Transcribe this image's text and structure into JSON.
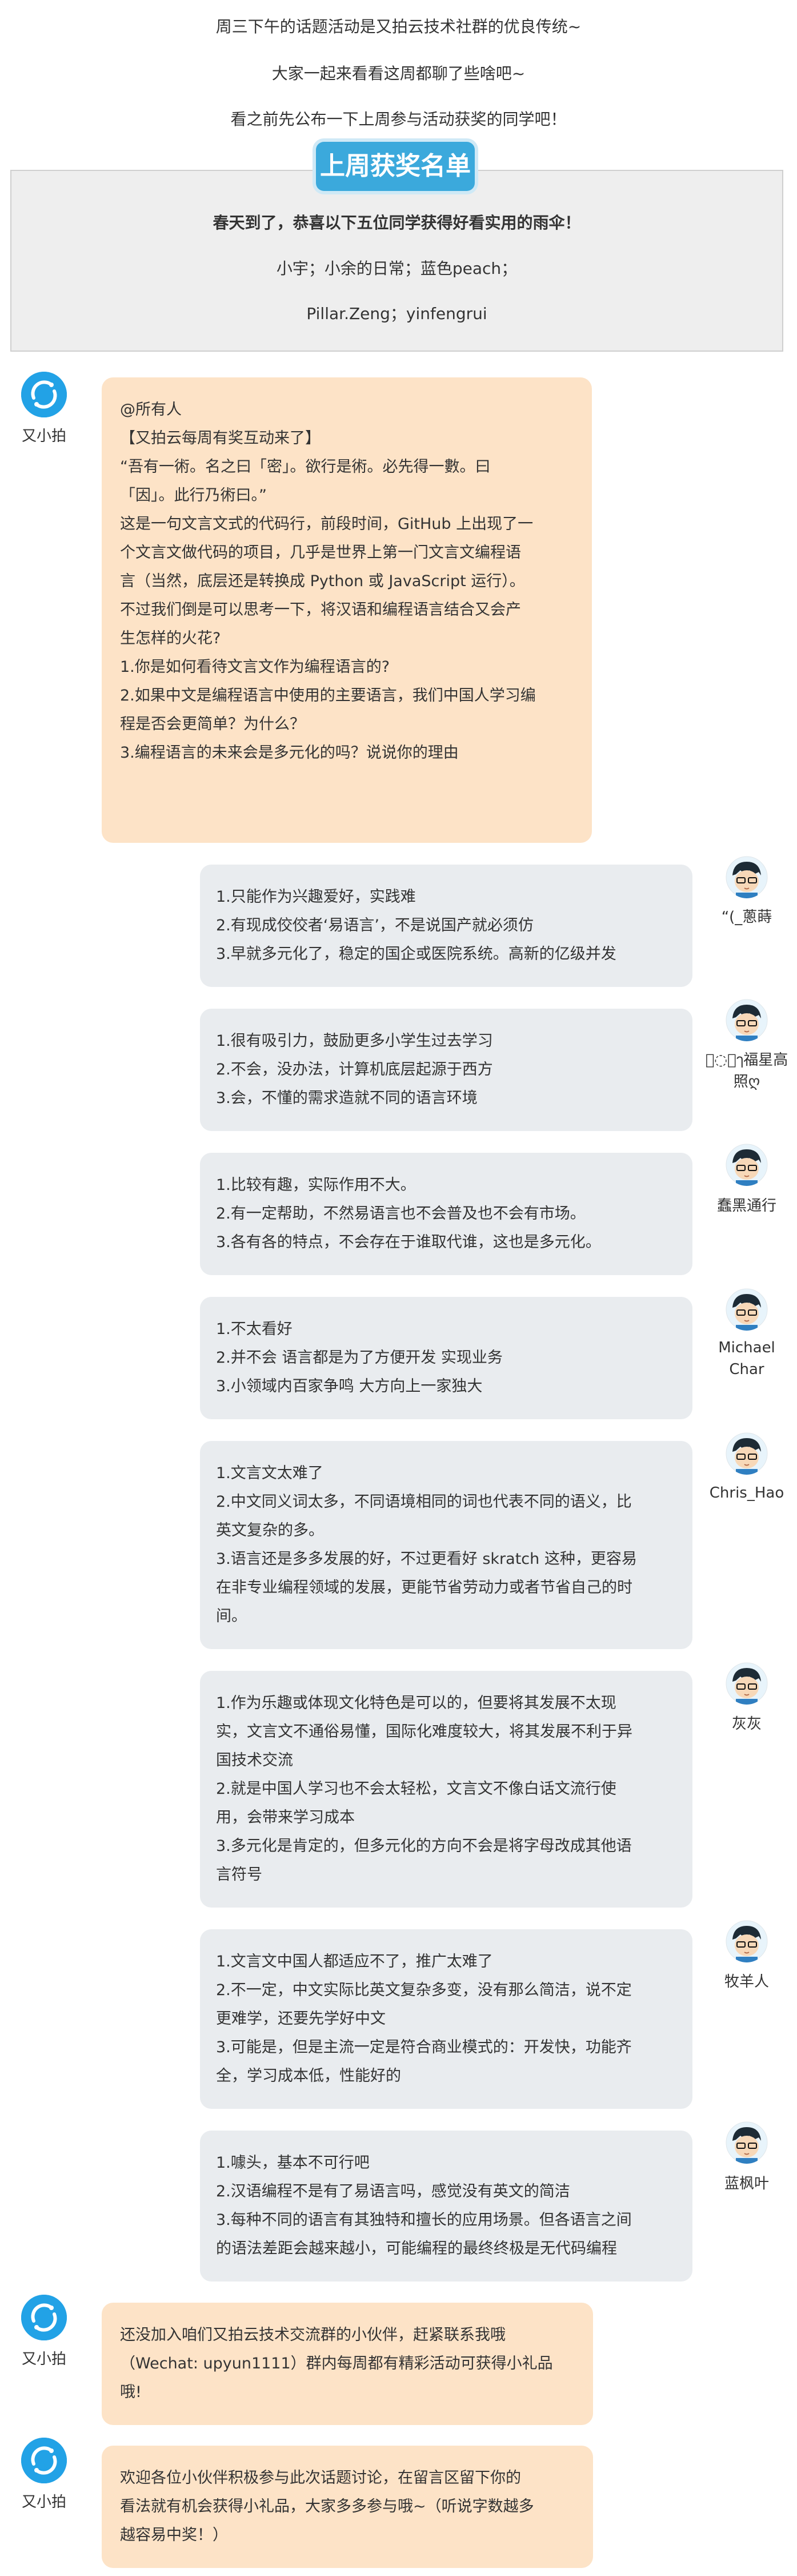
{
  "intro": [
    "周三下午的话题活动是又拍云技术社群的优良传统~",
    "大家一起来看看这周都聊了些啥吧~",
    "看之前先公布一下上周参与活动获奖的同学吧！"
  ],
  "award": {
    "title": "上周获奖名单",
    "line1": "春天到了，恭喜以下五位同学获得好看实用的雨伞！",
    "line2": "小宇；小余的日常；蓝色peach；",
    "line3": "Pillar.Zeng；yinfengrui"
  },
  "host_name": "又小拍",
  "post": {
    "lines": [
      "@所有人",
      "",
      "【又拍云每周有奖互动来了】",
      "“吾有一術。名之曰「密」。欲行是術。必先得一數。曰",
      "「因」。此行乃術曰。”",
      "这是一句文言文式的代码行，前段时间，GitHub 上出现了一",
      "个文言文做代码的项目，几乎是世界上第一门文言文编程语",
      "言（当然，底层还是转换成 Python 或 JavaScript 运行）。",
      "不过我们倒是可以思考一下，将汉语和编程语言结合又会产",
      "生怎样的火花?",
      "",
      "1.你是如何看待文言文作为编程语言的?",
      "2.如果中文是编程语言中使用的主要语言，我们中国人学习编",
      "程是否会更简单？为什么？",
      "3.编程语言的未来会是多元化的吗？说说你的理由"
    ]
  },
  "replies": [
    {
      "name": "“(_蔥蒔",
      "lines": [
        "1.只能作为兴趣爱好，实践难",
        "2.有现成佼佼者‘易语言’，不是说国产就必须仿",
        "3.早就多元化了，稳定的国企或医院系统。高新的亿级并发"
      ]
    },
    {
      "name": "ⓛ៉ๅ福星高照ღ",
      "lines": [
        "1.很有吸引力，鼓励更多小学生过去学习",
        "2.不会，没办法，计算机底层起源于西方",
        "3.会，不懂的需求造就不同的语言环境"
      ]
    },
    {
      "name": "蠢黑通行",
      "lines": [
        "1.比较有趣，实际作用不大。",
        "2.有一定帮助，不然易语言也不会普及也不会有市场。",
        "3.各有各的特点，不会存在于谁取代谁，这也是多元化。"
      ]
    },
    {
      "name": "Michael Char",
      "lines": [
        "1.不太看好",
        "2.并不会 语言都是为了方便开发 实现业务",
        "3.小领域内百家争鸣 大方向上一家独大"
      ]
    },
    {
      "name": "Chris_Hao",
      "lines": [
        "1.文言文太难了",
        "2.中文同义词太多，不同语境相同的词也代表不同的语义，比",
        "英文复杂的多。",
        "3.语言还是多多发展的好，不过更看好 skratch 这种，更容易",
        "在非专业编程领域的发展，更能节省劳动力或者节省自己的时",
        "间。"
      ]
    },
    {
      "name": "灰灰",
      "lines": [
        "1.作为乐趣或体现文化特色是可以的，但要将其发展不太现",
        "实，文言文不通俗易懂，国际化难度较大，将其发展不利于异",
        "国技术交流",
        "2.就是中国人学习也不会太轻松，文言文不像白话文流行使",
        "用，会带来学习成本",
        "3.多元化是肯定的，但多元化的方向不会是将字母改成其他语",
        "言符号"
      ]
    },
    {
      "name": "牧羊人",
      "lines": [
        "1.文言文中国人都适应不了，推广太难了",
        "2.不一定，中文实际比英文复杂多变，没有那么简洁，说不定",
        "更难学，还要先学好中文",
        "3.可能是，但是主流一定是符合商业模式的：开发快，功能齐",
        "全，学习成本低，性能好的"
      ]
    },
    {
      "name": "蓝枫叶",
      "lines": [
        "1.噱头，基本不可行吧",
        "2.汉语编程不是有了易语言吗，感觉没有英文的简洁",
        "3.每种不同的语言有其独特和擅长的应用场景。但各语言之间",
        "的语法差距会越来越小，可能编程的最终终极是无代码编程"
      ]
    }
  ],
  "closing": [
    {
      "lines": [
        "还没加入咱们又拍云技术交流群的小伙伴，赶紧联系我哦",
        "（Wechat: upyun1111）群内每周都有精彩活动可获得小礼品",
        "哦!"
      ]
    },
    {
      "lines": [
        "欢迎各位小伙伴积极参与此次话题讨论，在留言区留下你的",
        "看法就有机会获得小礼品，大家多多参与哦~（听说字数越多",
        "越容易中奖！）"
      ]
    }
  ],
  "colors": {
    "brand_blue": "#22a2e6",
    "host_bubble": "#fde3c7",
    "reply_bubble": "#e9ecef"
  }
}
